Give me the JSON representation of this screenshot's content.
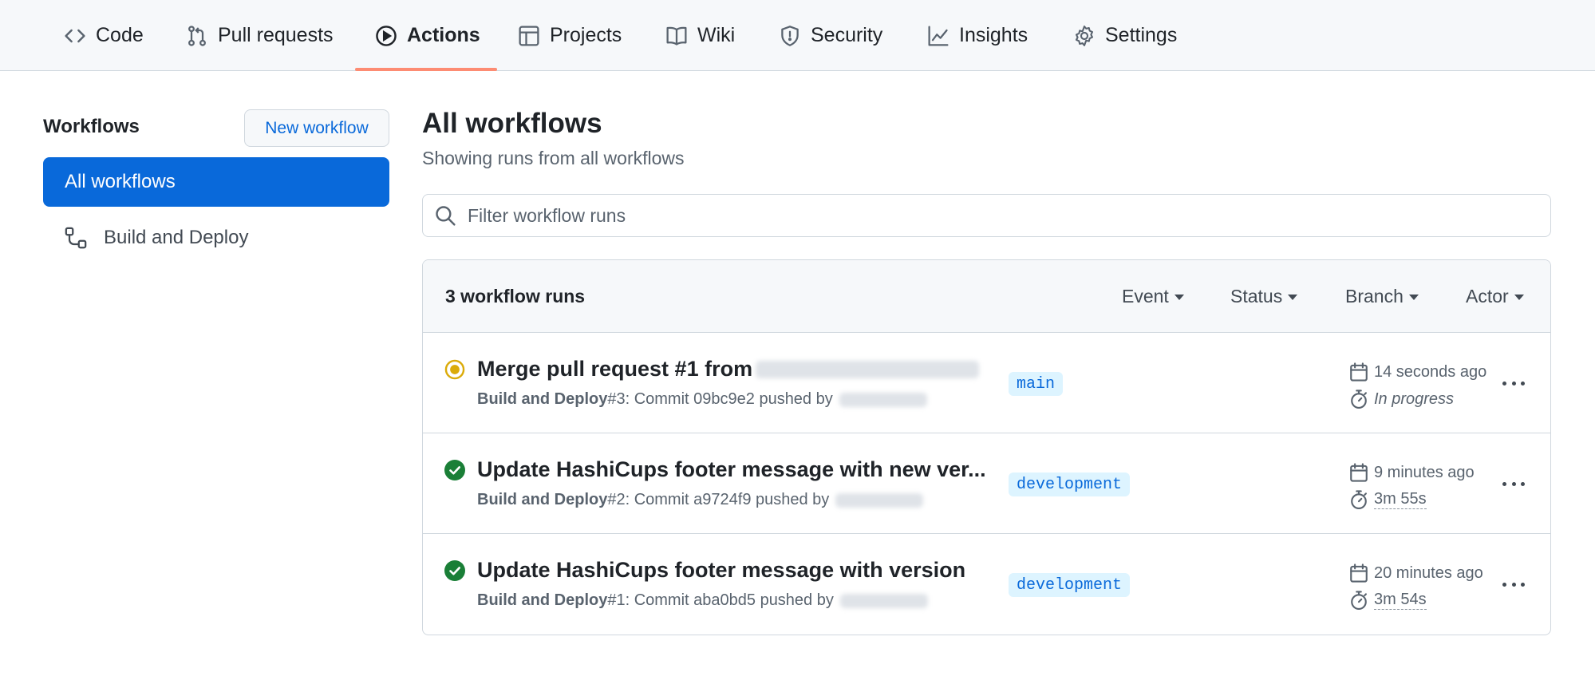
{
  "nav": {
    "tabs": [
      {
        "label": "Code",
        "icon": "code-icon"
      },
      {
        "label": "Pull requests",
        "icon": "pull-request-icon"
      },
      {
        "label": "Actions",
        "icon": "play-icon",
        "active": true
      },
      {
        "label": "Projects",
        "icon": "table-icon"
      },
      {
        "label": "Wiki",
        "icon": "book-icon"
      },
      {
        "label": "Security",
        "icon": "shield-icon"
      },
      {
        "label": "Insights",
        "icon": "graph-icon"
      },
      {
        "label": "Settings",
        "icon": "gear-icon"
      }
    ],
    "active_underline_color": "#fd8c73"
  },
  "sidebar": {
    "title": "Workflows",
    "new_button": "New workflow",
    "active_item": "All workflows",
    "items": [
      {
        "label": "Build and Deploy",
        "icon": "workflow-icon"
      }
    ]
  },
  "main": {
    "title": "All workflows",
    "subtitle": "Showing runs from all workflows",
    "filter_placeholder": "Filter workflow runs"
  },
  "runs": {
    "count_label": "3 workflow runs",
    "filters": [
      "Event",
      "Status",
      "Branch",
      "Actor"
    ],
    "rows": [
      {
        "status": "in-progress",
        "title": "Merge pull request #1 from",
        "workflow": "Build and Deploy",
        "meta": " #3: Commit 09bc9e2 pushed by",
        "branch": "main",
        "when": "14 seconds ago",
        "duration": "In progress"
      },
      {
        "status": "success",
        "title": "Update HashiCups footer message with new ver...",
        "workflow": "Build and Deploy",
        "meta": " #2: Commit a9724f9 pushed by",
        "branch": "development",
        "when": "9 minutes ago",
        "duration": "3m 55s"
      },
      {
        "status": "success",
        "title": "Update HashiCups footer message with version",
        "workflow": "Build and Deploy",
        "meta": " #1: Commit aba0bd5 pushed by",
        "branch": "development",
        "when": "20 minutes ago",
        "duration": "3m 54s"
      }
    ]
  },
  "colors": {
    "accent": "#0969da",
    "success": "#1a7f37",
    "in_progress": "#dbab09",
    "branch_bg": "#ddf4ff"
  }
}
